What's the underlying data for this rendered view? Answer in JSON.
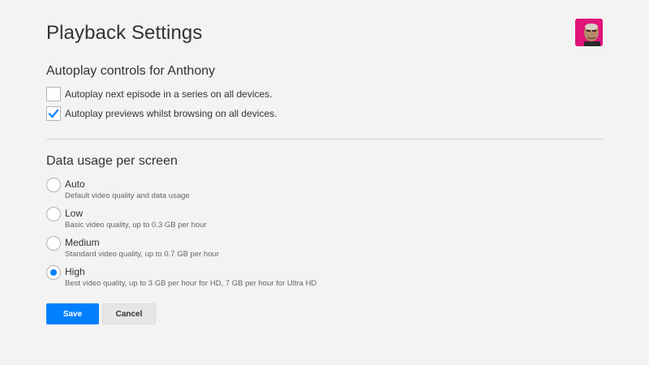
{
  "page": {
    "title": "Playback Settings"
  },
  "profile": {
    "avatar_icon": "profile-avatar-icon"
  },
  "autoplay": {
    "heading": "Autoplay controls for Anthony",
    "options": [
      {
        "label": "Autoplay next episode in a series on all devices.",
        "checked": false
      },
      {
        "label": "Autoplay previews whilst browsing on all devices.",
        "checked": true
      }
    ]
  },
  "data_usage": {
    "heading": "Data usage per screen",
    "selected": "High",
    "options": [
      {
        "label": "Auto",
        "description": "Default video quality and data usage",
        "selected": false
      },
      {
        "label": "Low",
        "description": "Basic video quality, up to 0.3 GB per hour",
        "selected": false
      },
      {
        "label": "Medium",
        "description": "Standard video quality, up to 0.7 GB per hour",
        "selected": false
      },
      {
        "label": "High",
        "description": "Best video quality, up to 3 GB per hour for HD, 7 GB per hour for Ultra HD",
        "selected": true
      }
    ]
  },
  "buttons": {
    "save_label": "Save",
    "cancel_label": "Cancel"
  },
  "colors": {
    "accent": "#0080ff",
    "background": "#f3f3f3",
    "text": "#333333",
    "avatar_bg": "#e0147a"
  }
}
